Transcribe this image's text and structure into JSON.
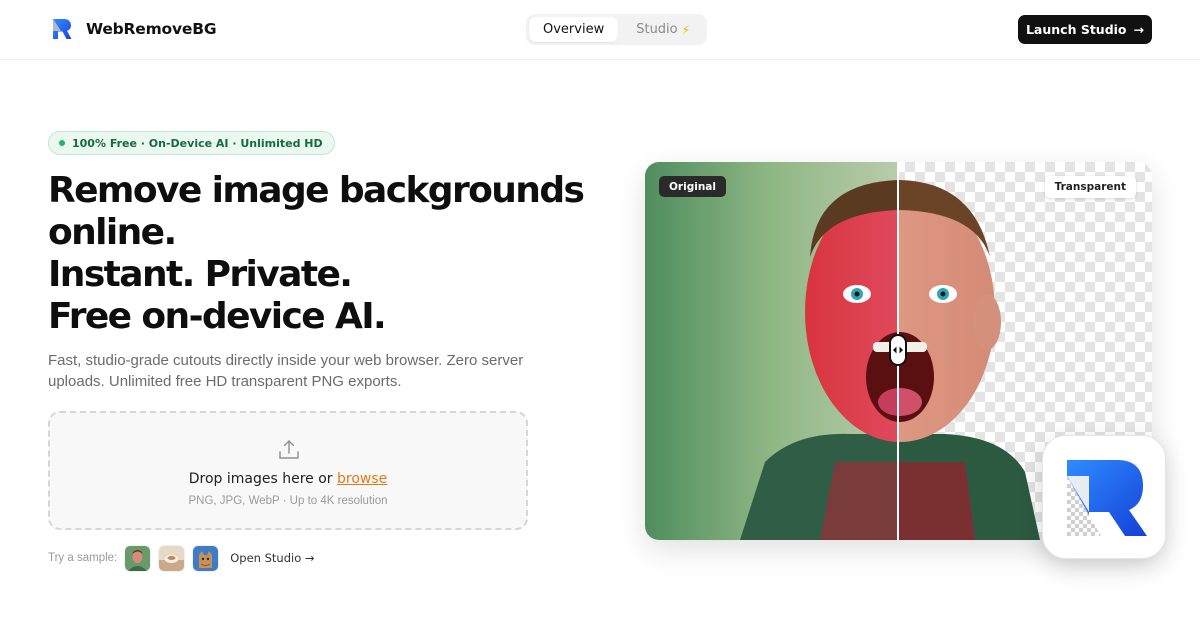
{
  "header": {
    "brand_name": "WebRemoveBG",
    "nav": [
      {
        "label": "Overview",
        "active": true
      },
      {
        "label": "Studio",
        "icon": "bolt-icon",
        "active": false
      }
    ],
    "launch_label": "Launch Studio",
    "launch_icon": "arrow-right-icon"
  },
  "hero": {
    "badge": "100% Free · On-Device AI · Unlimited HD",
    "headline_lines": [
      "Remove image backgrounds",
      "online.",
      "Instant. Private.",
      "Free on-device AI."
    ],
    "subtext": "Fast, studio-grade cutouts directly inside your web browser. Zero server uploads. Unlimited free HD transparent PNG exports."
  },
  "dropzone": {
    "title_prefix": "Drop images here or",
    "browse_label": "browse",
    "subtitle": "PNG, JPG, WebP · Up to 4K resolution"
  },
  "samples": {
    "label": "Try a sample:",
    "thumbnails": [
      "sample-portrait-thumb",
      "sample-product-thumb",
      "sample-cat-thumb"
    ],
    "open_studio_label": "Open Studio →"
  },
  "preview": {
    "original_label": "Original",
    "transparent_label": "Transparent"
  },
  "colors": {
    "accent_orange": "#e07b1a",
    "badge_green": "#1fb866",
    "logo_blue": "#1b5cff"
  }
}
